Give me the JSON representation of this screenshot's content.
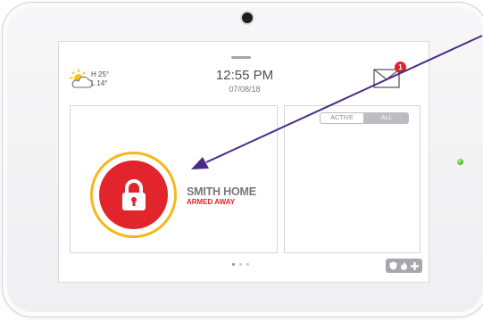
{
  "weather": {
    "icon": "partly-cloudy-icon",
    "high": "H 25°",
    "low": "L 14°"
  },
  "clock": {
    "time": "12:55 PM",
    "date": "07/08/18"
  },
  "mail": {
    "icon": "envelope-icon",
    "badge_count": "1"
  },
  "security": {
    "icon": "padlock-icon",
    "home_name": "SMITH HOME",
    "status": "ARMED AWAY"
  },
  "filter": {
    "active_label": "ACTIVE",
    "all_label": "ALL",
    "selected": "ALL"
  },
  "pager": {
    "pages": 3,
    "current": 1
  },
  "quick_actions": {
    "icons": [
      "shield-icon",
      "flame-icon",
      "plus-icon"
    ]
  },
  "colors": {
    "armed_red": "#e2252d",
    "ring_yellow": "#f7b718",
    "badge_red": "#e0242b",
    "arrow_purple": "#4b2a8a"
  }
}
